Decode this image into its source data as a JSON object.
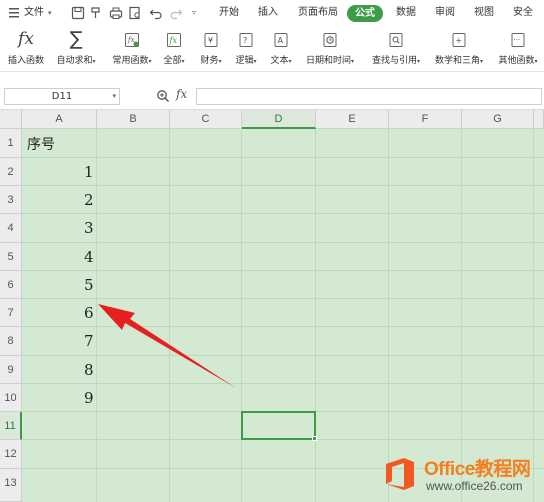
{
  "menu": {
    "file_label": "文件",
    "tabs": [
      "开始",
      "插入",
      "页面布局",
      "公式",
      "数据",
      "审阅",
      "视图",
      "安全"
    ],
    "active_tab": "公式"
  },
  "ribbon": {
    "items": [
      {
        "label": "插入函数",
        "icon": "fx-icon"
      },
      {
        "label": "自动求和",
        "icon": "sigma-icon"
      },
      {
        "label": "常用函数",
        "icon": "fx-star-icon"
      },
      {
        "label": "全部",
        "icon": "fx-box-icon"
      },
      {
        "label": "财务",
        "icon": "finance-book-icon"
      },
      {
        "label": "逻辑",
        "icon": "logic-book-icon"
      },
      {
        "label": "文本",
        "icon": "text-book-icon"
      },
      {
        "label": "日期和时间",
        "icon": "clock-book-icon"
      },
      {
        "label": "查找与引用",
        "icon": "search-book-icon"
      },
      {
        "label": "数学和三角",
        "icon": "math-book-icon"
      },
      {
        "label": "其他函数",
        "icon": "more-book-icon"
      }
    ]
  },
  "formula_bar": {
    "name_box": "D11",
    "fx_label": "fx",
    "formula": ""
  },
  "sheet": {
    "columns": [
      "A",
      "B",
      "C",
      "D",
      "E",
      "F",
      "G"
    ],
    "rows": [
      "1",
      "2",
      "3",
      "4",
      "5",
      "6",
      "7",
      "8",
      "9",
      "10",
      "11",
      "12",
      "13"
    ],
    "selected_column": "D",
    "selected_row": "11",
    "header_cell": "序号",
    "values": [
      "1",
      "2",
      "3",
      "4",
      "5",
      "6",
      "7",
      "8",
      "9"
    ]
  },
  "watermark": {
    "title": "Office教程网",
    "url": "www.office26.com"
  },
  "colors": {
    "accent": "#3c9c48",
    "sheet_bg": "#d3e9d2",
    "arrow": "#e5201f",
    "watermark_orange": "#f47f20"
  }
}
